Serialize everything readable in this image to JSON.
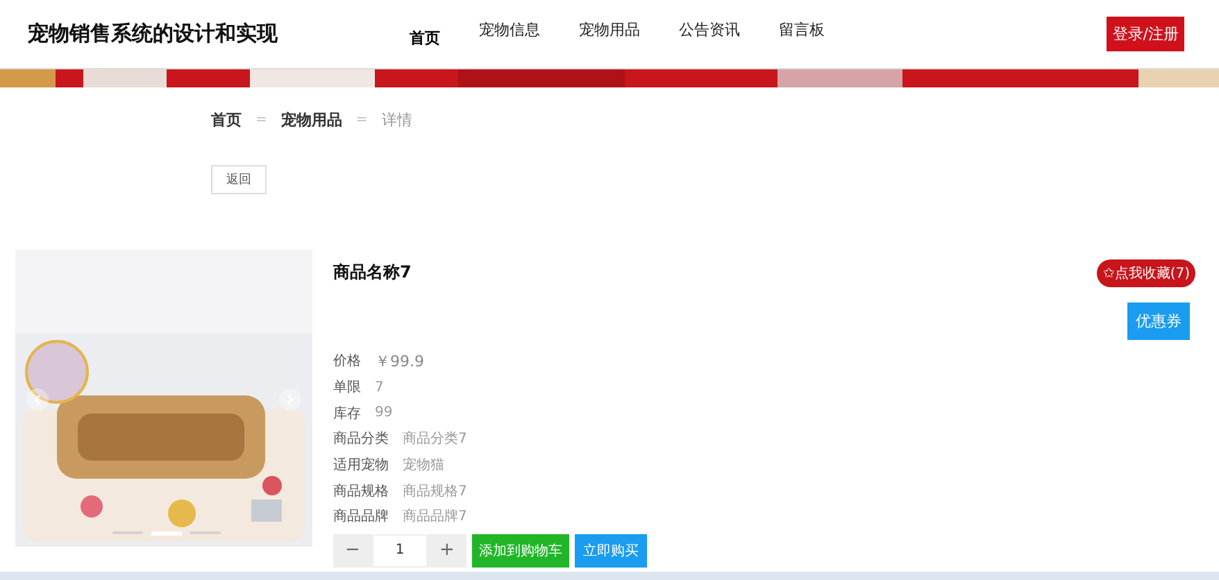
{
  "header": {
    "title": "宠物销售系统的设计和实现",
    "nav": [
      {
        "label": "首页",
        "selected": true
      },
      {
        "label": "宠物信息",
        "selected": false
      },
      {
        "label": "宠物用品",
        "selected": false
      },
      {
        "label": "公告资讯",
        "selected": false
      },
      {
        "label": "留言板",
        "selected": false
      }
    ],
    "login": "登录/注册"
  },
  "breadcrumb": [
    {
      "label": "首页",
      "current": false
    },
    {
      "label": "宠物用品",
      "current": false
    },
    {
      "label": "详情",
      "current": true
    }
  ],
  "breadcrumb_separator": "=",
  "back_button": "返回",
  "product": {
    "image": {
      "kind": "picture",
      "slides": [
        {
          "selected": false
        },
        {
          "selected": true
        },
        {
          "selected": false
        }
      ]
    },
    "name": "商品名称7",
    "favorite": "✩点我收藏(7)",
    "coupon": "优惠券",
    "attributes": [
      {
        "label": "价格",
        "value": "￥99.9",
        "kind": "price"
      },
      {
        "label": "单限",
        "value": "7",
        "kind": "plain"
      },
      {
        "label": "库存",
        "value": "99",
        "kind": "plain"
      },
      {
        "label": "商品分类",
        "value": "商品分类7",
        "kind": "plain"
      },
      {
        "label": "适用宠物",
        "value": "宠物猫",
        "kind": "plain"
      },
      {
        "label": "商品规格",
        "value": "商品规格7",
        "kind": "plain"
      },
      {
        "label": "商品品牌",
        "value": "商品品牌7",
        "kind": "plain"
      }
    ],
    "quantity": {
      "minus": "−",
      "value": "1",
      "plus": "+"
    },
    "add_to_cart": "添加到购物车",
    "buy_now": "立即购买"
  }
}
